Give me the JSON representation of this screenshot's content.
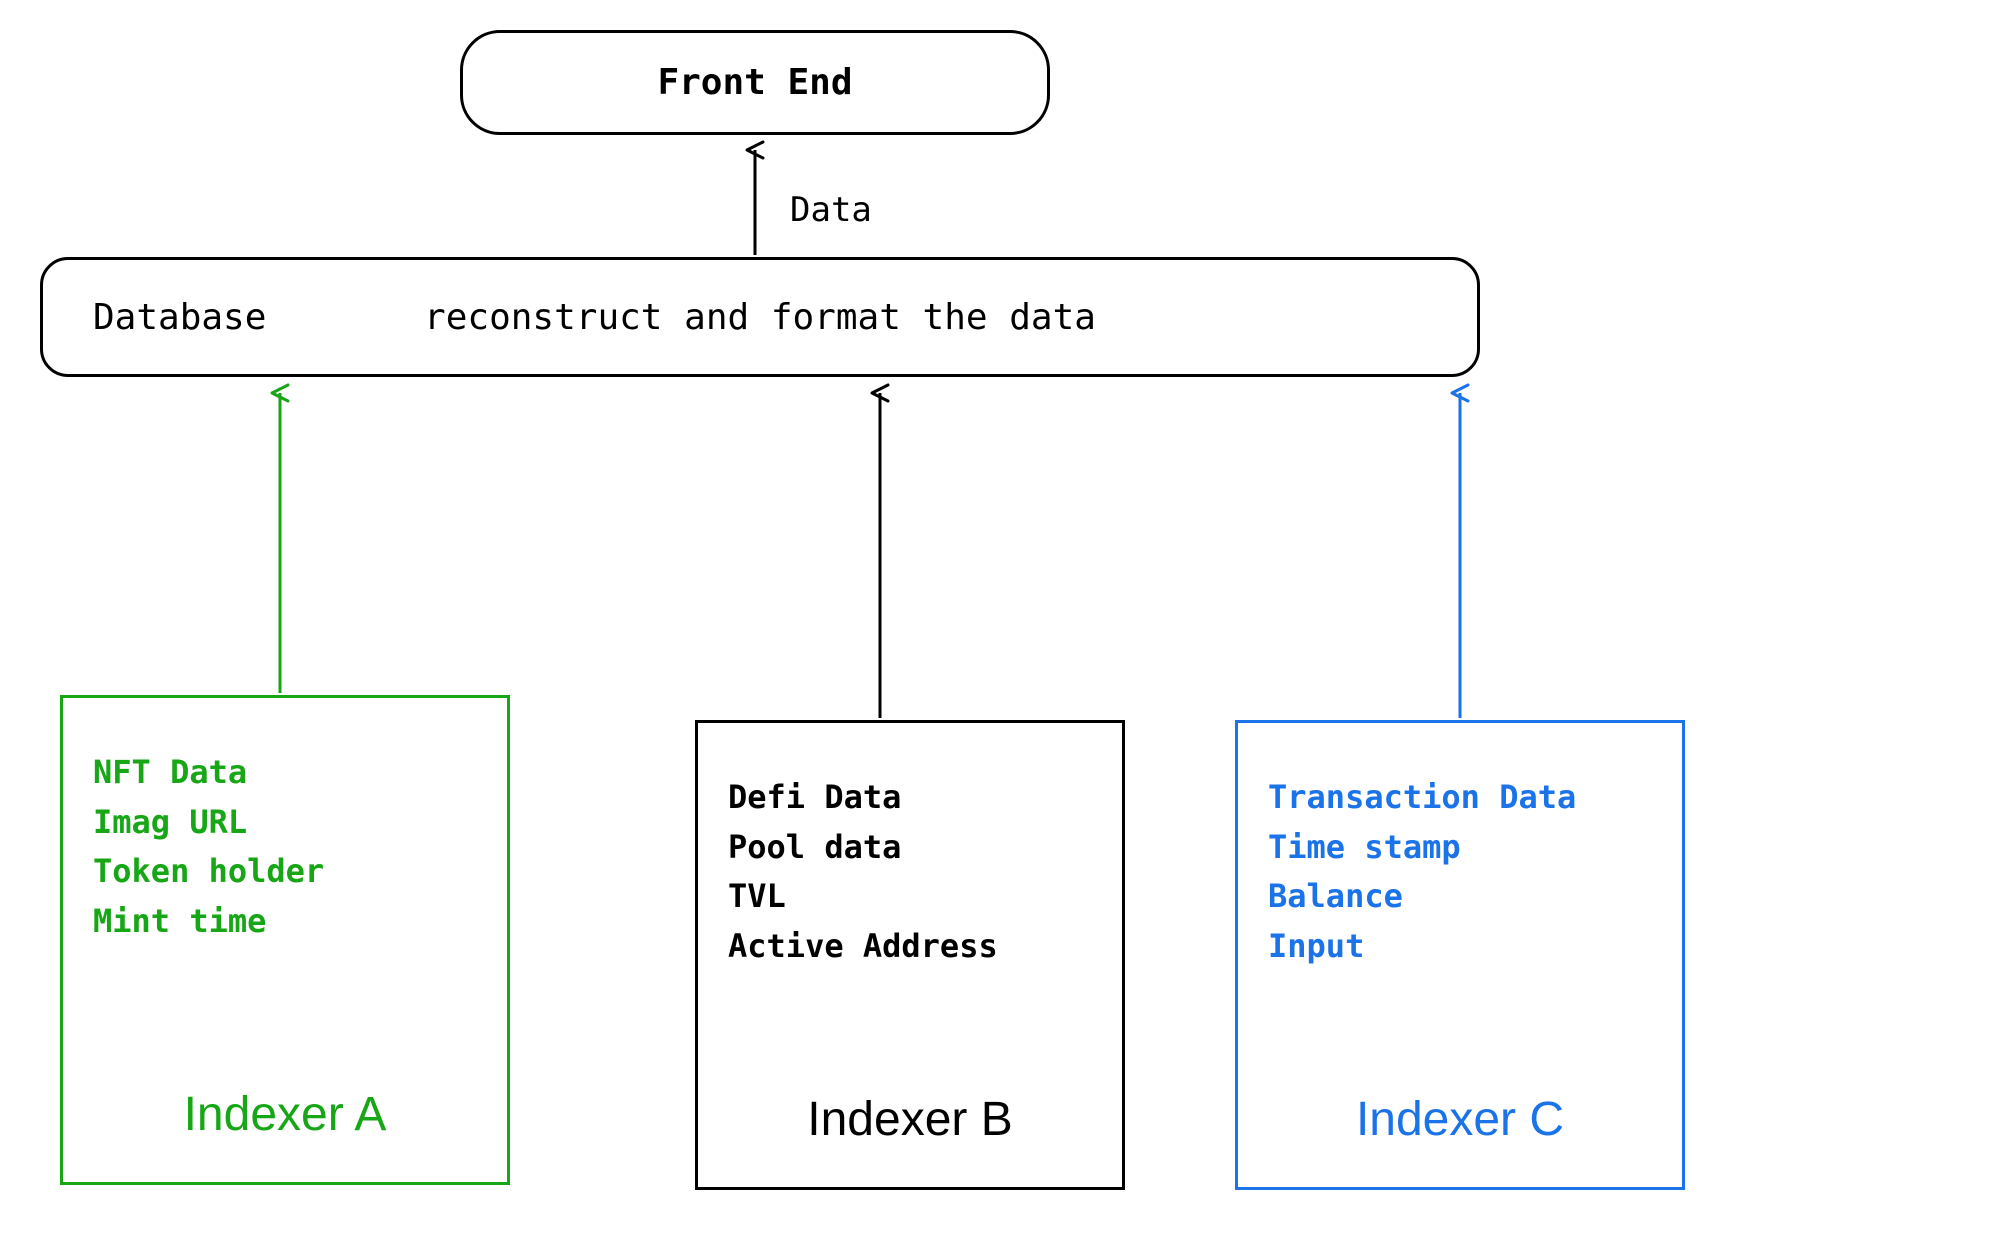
{
  "frontEnd": {
    "label": "Front End"
  },
  "dataArrow": {
    "label": "Data"
  },
  "database": {
    "leftLabel": "Database",
    "centerLabel": "reconstruct and format the data"
  },
  "indexers": {
    "a": {
      "title": "Indexer A",
      "items": [
        "NFT Data",
        "Imag URL",
        "Token holder",
        "Mint time"
      ],
      "color": "#16a616"
    },
    "b": {
      "title": "Indexer B",
      "items": [
        "Defi Data",
        "Pool data",
        "TVL",
        "Active Address"
      ],
      "color": "#000000"
    },
    "c": {
      "title": "Indexer C",
      "items": [
        "Transaction Data",
        "Time stamp",
        "Balance",
        "Input"
      ],
      "color": "#1a73e8"
    }
  },
  "colors": {
    "green": "#16a616",
    "black": "#000000",
    "blue": "#1a73e8"
  }
}
